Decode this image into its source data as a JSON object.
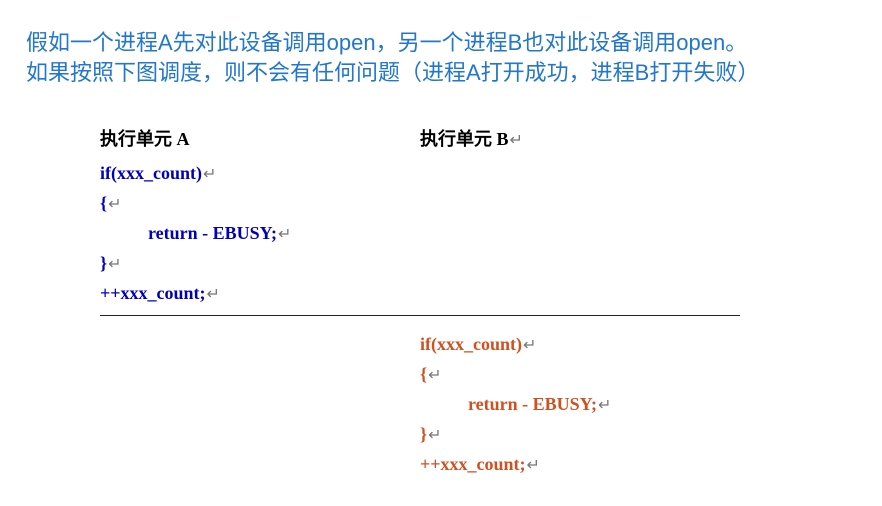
{
  "title": {
    "line1": "假如一个进程A先对此设备调用open，另一个进程B也对此设备调用open。",
    "line2": "如果按照下图调度，则不会有任何问题（进程A打开成功，进程B打开失败）"
  },
  "headers": {
    "colA": "执行单元 A",
    "colB": "执行单元 B"
  },
  "marks": {
    "enter": "↵"
  },
  "codeA": {
    "l1": "if(xxx_count)",
    "l2": "{",
    "l3": "return - EBUSY;",
    "l4": "}",
    "l5": "++xxx_count;"
  },
  "codeB": {
    "l1": "if(xxx_count)",
    "l2": "{",
    "l3": "return - EBUSY;",
    "l4": "}",
    "l5": "++xxx_count;"
  }
}
